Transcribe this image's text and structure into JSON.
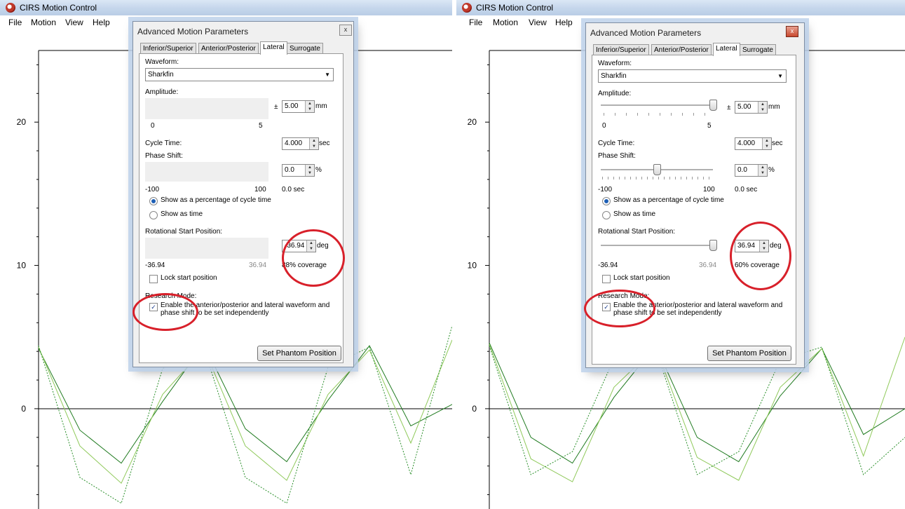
{
  "app": {
    "title": "CIRS Motion Control",
    "menu": [
      "File",
      "Motion",
      "View",
      "Help"
    ]
  },
  "chart_data": [
    {
      "type": "line",
      "yticks": [
        20,
        10,
        0
      ],
      "ylim": [
        -7,
        25
      ],
      "series": [
        {
          "color": "#1f7a1f",
          "style": "solid",
          "x": [
            0,
            10,
            20,
            30,
            40,
            50,
            60,
            70,
            80,
            90,
            100
          ],
          "values": [
            4.2,
            -1.5,
            -3.8,
            0.5,
            4.5,
            -1.4,
            -3.7,
            0.6,
            4.4,
            -1.2,
            0.3
          ]
        },
        {
          "color": "#8fc95a",
          "style": "solid",
          "x": [
            0,
            10,
            20,
            30,
            40,
            50,
            60,
            70,
            80,
            90,
            100
          ],
          "values": [
            4.3,
            -2.6,
            -5.2,
            1.0,
            4.2,
            -2.6,
            -5.0,
            1.0,
            4.1,
            -2.4,
            4.8
          ]
        },
        {
          "color": "#2a8f2a",
          "style": "dashed",
          "x": [
            0,
            10,
            20,
            30,
            40,
            50,
            60,
            70,
            80,
            90,
            100
          ],
          "values": [
            4.4,
            -4.8,
            -6.6,
            2.8,
            4.2,
            -4.8,
            -6.6,
            2.9,
            4.3,
            -4.6,
            5.8
          ]
        }
      ]
    },
    {
      "type": "line",
      "yticks": [
        20,
        10,
        0
      ],
      "ylim": [
        -7,
        25
      ],
      "series": [
        {
          "color": "#1f7a1f",
          "style": "solid",
          "x": [
            0,
            10,
            20,
            30,
            40,
            50,
            60,
            70,
            80,
            90,
            100
          ],
          "values": [
            4.6,
            -2.0,
            -3.8,
            0.8,
            4.4,
            -2.0,
            -3.7,
            0.9,
            4.2,
            -1.8,
            0.0
          ]
        },
        {
          "color": "#8fc95a",
          "style": "solid",
          "x": [
            0,
            10,
            20,
            30,
            40,
            50,
            60,
            70,
            80,
            90,
            100
          ],
          "values": [
            4.5,
            -3.5,
            -5.1,
            1.5,
            4.3,
            -3.4,
            -5.0,
            1.5,
            4.2,
            -3.3,
            5.0
          ]
        },
        {
          "color": "#2a8f2a",
          "style": "dashed",
          "x": [
            0,
            10,
            20,
            30,
            40,
            50,
            60,
            70,
            80,
            90,
            100
          ],
          "values": [
            4.4,
            -4.6,
            -3.0,
            3.5,
            4.2,
            -4.6,
            -3.0,
            3.4,
            4.3,
            -4.6,
            -2.0
          ]
        }
      ]
    }
  ],
  "dialogs": [
    {
      "title": "Advanced Motion Parameters",
      "close": "x",
      "tabs": [
        "Inferior/Superior",
        "Anterior/Posterior",
        "Lateral",
        "Surrogate"
      ],
      "active_tab": "Lateral",
      "waveform_label": "Waveform:",
      "waveform_value": "Sharkfin",
      "amplitude_label": "Amplitude:",
      "amplitude_pm": "±",
      "amplitude_value": "5.00",
      "amplitude_unit": "mm",
      "amplitude_min": "0",
      "amplitude_max": "5",
      "cycle_label": "Cycle Time:",
      "cycle_value": "4.000",
      "cycle_unit": "sec",
      "phase_label": "Phase Shift:",
      "phase_value": "0.0",
      "phase_unit": "%",
      "phase_min": "-100",
      "phase_max": "100",
      "phase_sec": "0.0 sec",
      "radio_percent": "Show as a percentage of cycle time",
      "radio_time": "Show as time",
      "rot_label": "Rotational Start Position:",
      "rot_value": "-36.94",
      "rot_unit": "deg",
      "rot_min": "-36.94",
      "rot_max": "36.94",
      "coverage": "88% coverage",
      "lock_label": "Lock start position",
      "research_label": "Research Mode:",
      "research_check": "Enable the anterior/posterior and lateral waveform and phase shift to be set independently",
      "set_button": "Set Phantom Position",
      "sliders_visible": false
    },
    {
      "title": "Advanced Motion Parameters",
      "close": "x",
      "tabs": [
        "Inferior/Superior",
        "Anterior/Posterior",
        "Lateral",
        "Surrogate"
      ],
      "active_tab": "Lateral",
      "waveform_label": "Waveform:",
      "waveform_value": "Sharkfin",
      "amplitude_label": "Amplitude:",
      "amplitude_pm": "±",
      "amplitude_value": "5.00",
      "amplitude_unit": "mm",
      "amplitude_min": "0",
      "amplitude_max": "5",
      "amplitude_level": 1.0,
      "cycle_label": "Cycle Time:",
      "cycle_value": "4.000",
      "cycle_unit": "sec",
      "phase_label": "Phase Shift:",
      "phase_value": "0.0",
      "phase_unit": "%",
      "phase_min": "-100",
      "phase_max": "100",
      "phase_sec": "0.0 sec",
      "phase_level": 0.5,
      "radio_percent": "Show as a percentage of cycle time",
      "radio_time": "Show as time",
      "rot_label": "Rotational Start Position:",
      "rot_value": "36.94",
      "rot_unit": "deg",
      "rot_min": "-36.94",
      "rot_max": "36.94",
      "rot_level": 1.0,
      "coverage": "60% coverage",
      "lock_label": "Lock start position",
      "research_label": "Research Mode:",
      "research_check": "Enable the anterior/posterior and lateral waveform and phase shift to be set independently",
      "set_button": "Set Phantom Position",
      "sliders_visible": true
    }
  ]
}
